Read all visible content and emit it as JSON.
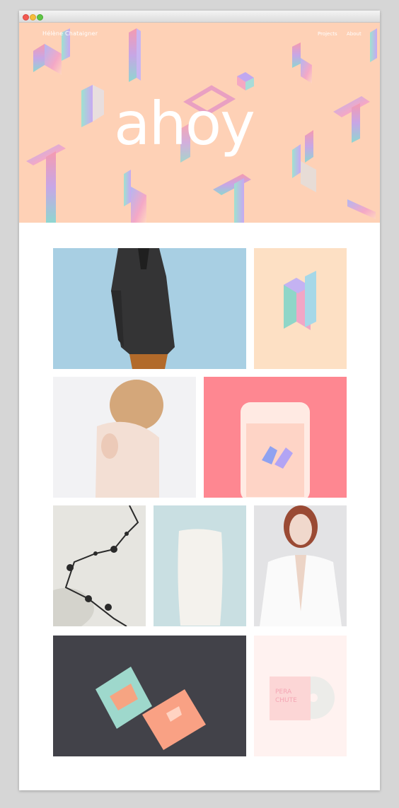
{
  "window": {
    "controls": [
      "close",
      "minimize",
      "maximize"
    ]
  },
  "header": {
    "brand": "Hélène Chataigner",
    "nav": [
      {
        "label": "Projects"
      },
      {
        "label": "About"
      }
    ]
  },
  "hero": {
    "headline": "ahoy"
  },
  "projects": [
    {
      "name": "menswear-jacket",
      "bg": "#a8cfe3"
    },
    {
      "name": "iridescent-letter",
      "bg": "#fde0c4"
    },
    {
      "name": "perfume-portrait",
      "bg": "#f2f2f4"
    },
    {
      "name": "phone-hands",
      "bg": "#fe8791"
    },
    {
      "name": "route-map",
      "bg": "#e6e5e0"
    },
    {
      "name": "pillow",
      "bg": "#c9dfe2"
    },
    {
      "name": "portrait-white-coat",
      "bg": "#e3e3e5"
    },
    {
      "name": "business-cards",
      "bg": "#424249"
    },
    {
      "name": "record-sleeve",
      "bg": "#fff2f0"
    }
  ],
  "record_sleeve_text": [
    "PERA",
    "CHUTE"
  ],
  "colors": {
    "hero": "#fed1b6",
    "page": "#ffffff",
    "frame": "#d6d6d6"
  }
}
